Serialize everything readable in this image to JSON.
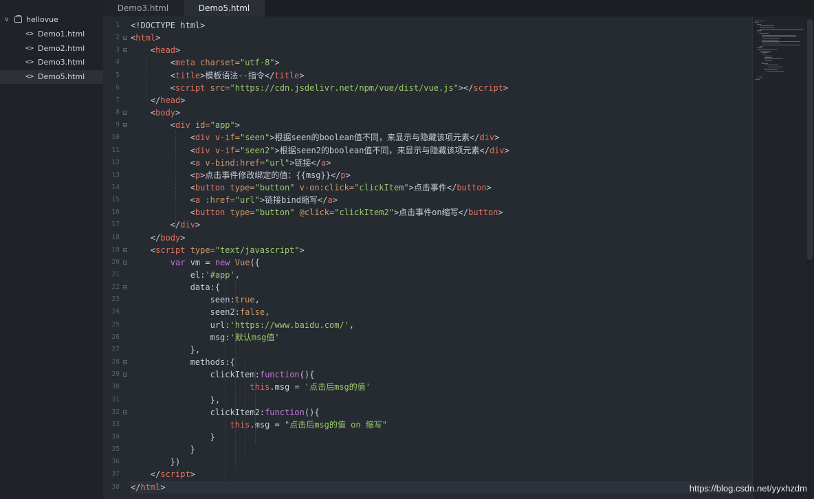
{
  "sidebar": {
    "folder": "hellovue",
    "files": [
      "Demo1.html",
      "Demo2.html",
      "Demo3.html",
      "Demo5.html"
    ],
    "active_index": 3,
    "folder_icon": "folder-icon",
    "file_icon": "code-file-icon"
  },
  "tabs": [
    {
      "label": "Demo3.html",
      "active": false
    },
    {
      "label": "Demo5.html",
      "active": true
    }
  ],
  "editor": {
    "current_line": 38,
    "foldable_lines": [
      2,
      3,
      8,
      9,
      19,
      20,
      22,
      28,
      29,
      32
    ],
    "lines": [
      [
        [
          "<!DOCTYPE html>",
          "k-plain"
        ]
      ],
      [
        [
          "<",
          "k-punct"
        ],
        [
          "html",
          "k-tag"
        ],
        [
          ">",
          "k-punct"
        ]
      ],
      [
        [
          "    <",
          "k-punct"
        ],
        [
          "head",
          "k-tag"
        ],
        [
          ">",
          "k-punct"
        ]
      ],
      [
        [
          "        <",
          "k-punct"
        ],
        [
          "meta",
          "k-tag"
        ],
        [
          " charset=",
          "k-attr"
        ],
        [
          "\"utf-8\"",
          "k-str"
        ],
        [
          ">",
          "k-punct"
        ]
      ],
      [
        [
          "        <",
          "k-punct"
        ],
        [
          "title",
          "k-tag"
        ],
        [
          ">模板语法--指令</",
          "k-punct"
        ],
        [
          "title",
          "k-tag"
        ],
        [
          ">",
          "k-punct"
        ]
      ],
      [
        [
          "        <",
          "k-punct"
        ],
        [
          "script",
          "k-tag"
        ],
        [
          " src=",
          "k-attr"
        ],
        [
          "\"https://cdn.jsdelivr.net/npm/vue/dist/vue.js\"",
          "k-str"
        ],
        [
          "></",
          "k-punct"
        ],
        [
          "script",
          "k-tag"
        ],
        [
          ">",
          "k-punct"
        ]
      ],
      [
        [
          "    </",
          "k-punct"
        ],
        [
          "head",
          "k-tag"
        ],
        [
          ">",
          "k-punct"
        ]
      ],
      [
        [
          "    <",
          "k-punct"
        ],
        [
          "body",
          "k-tag"
        ],
        [
          ">",
          "k-punct"
        ]
      ],
      [
        [
          "        <",
          "k-punct"
        ],
        [
          "div",
          "k-tag"
        ],
        [
          " id=",
          "k-attr"
        ],
        [
          "\"app\"",
          "k-str"
        ],
        [
          ">",
          "k-punct"
        ]
      ],
      [
        [
          "            <",
          "k-punct"
        ],
        [
          "div",
          "k-tag"
        ],
        [
          " v-if=",
          "k-attr"
        ],
        [
          "\"seen\"",
          "k-str"
        ],
        [
          ">根据seen的boolean值不同，来显示与隐藏该项元素</",
          "k-punct"
        ],
        [
          "div",
          "k-tag"
        ],
        [
          ">",
          "k-punct"
        ]
      ],
      [
        [
          "            <",
          "k-punct"
        ],
        [
          "div",
          "k-tag"
        ],
        [
          " v-if=",
          "k-attr"
        ],
        [
          "\"seen2\"",
          "k-str"
        ],
        [
          ">根据seen2的boolean值不同，来显示与隐藏该项元素</",
          "k-punct"
        ],
        [
          "div",
          "k-tag"
        ],
        [
          ">",
          "k-punct"
        ]
      ],
      [
        [
          "            <",
          "k-punct"
        ],
        [
          "a",
          "k-tag"
        ],
        [
          " v-bind:href=",
          "k-attr"
        ],
        [
          "\"url\"",
          "k-str"
        ],
        [
          ">链接</",
          "k-punct"
        ],
        [
          "a",
          "k-tag"
        ],
        [
          ">",
          "k-punct"
        ]
      ],
      [
        [
          "            <",
          "k-punct"
        ],
        [
          "p",
          "k-tag"
        ],
        [
          ">点击事件修改绑定的值：{{msg}}</",
          "k-punct"
        ],
        [
          "p",
          "k-tag"
        ],
        [
          ">",
          "k-punct"
        ]
      ],
      [
        [
          "            <",
          "k-punct"
        ],
        [
          "button",
          "k-tag"
        ],
        [
          " type=",
          "k-attr"
        ],
        [
          "\"button\"",
          "k-str"
        ],
        [
          " v-on:click=",
          "k-attr"
        ],
        [
          "\"clickItem\"",
          "k-str"
        ],
        [
          ">点击事件</",
          "k-punct"
        ],
        [
          "button",
          "k-tag"
        ],
        [
          ">",
          "k-punct"
        ]
      ],
      [
        [
          "            <",
          "k-punct"
        ],
        [
          "a",
          "k-tag"
        ],
        [
          " :href=",
          "k-attr"
        ],
        [
          "\"url\"",
          "k-str"
        ],
        [
          ">链接bind缩写</",
          "k-punct"
        ],
        [
          "a",
          "k-tag"
        ],
        [
          ">",
          "k-punct"
        ]
      ],
      [
        [
          "            <",
          "k-punct"
        ],
        [
          "button",
          "k-tag"
        ],
        [
          " type=",
          "k-attr"
        ],
        [
          "\"button\"",
          "k-str"
        ],
        [
          " @click=",
          "k-attr"
        ],
        [
          "\"clickItem2\"",
          "k-str"
        ],
        [
          ">点击事件on缩写</",
          "k-punct"
        ],
        [
          "button",
          "k-tag"
        ],
        [
          ">",
          "k-punct"
        ]
      ],
      [
        [
          "        </",
          "k-punct"
        ],
        [
          "div",
          "k-tag"
        ],
        [
          ">",
          "k-punct"
        ]
      ],
      [
        [
          "    </",
          "k-punct"
        ],
        [
          "body",
          "k-tag"
        ],
        [
          ">",
          "k-punct"
        ]
      ],
      [
        [
          "    <",
          "k-punct"
        ],
        [
          "script",
          "k-tag"
        ],
        [
          " type=",
          "k-attr"
        ],
        [
          "\"text/javascript\"",
          "k-str"
        ],
        [
          ">",
          "k-punct"
        ]
      ],
      [
        [
          "        ",
          "k-plain"
        ],
        [
          "var",
          "k-kw"
        ],
        [
          " vm = ",
          "k-plain"
        ],
        [
          "new",
          "k-kw"
        ],
        [
          " ",
          "k-plain"
        ],
        [
          "Vue",
          "k-attr"
        ],
        [
          "({",
          "k-plain"
        ]
      ],
      [
        [
          "            el:",
          "k-plain"
        ],
        [
          "'#app'",
          "k-str"
        ],
        [
          ",",
          "k-plain"
        ]
      ],
      [
        [
          "            data:{",
          "k-plain"
        ]
      ],
      [
        [
          "                seen:",
          "k-plain"
        ],
        [
          "true",
          "k-attr"
        ],
        [
          ",",
          "k-plain"
        ]
      ],
      [
        [
          "                seen2:",
          "k-plain"
        ],
        [
          "false",
          "k-attr"
        ],
        [
          ",",
          "k-plain"
        ]
      ],
      [
        [
          "                url:",
          "k-plain"
        ],
        [
          "'https://www.baidu.com/'",
          "k-str"
        ],
        [
          ",",
          "k-plain"
        ]
      ],
      [
        [
          "                msg:",
          "k-plain"
        ],
        [
          "'默认msg值'",
          "k-str"
        ]
      ],
      [
        [
          "            },",
          "k-plain"
        ]
      ],
      [
        [
          "            methods:{",
          "k-plain"
        ]
      ],
      [
        [
          "                clickItem:",
          "k-plain"
        ],
        [
          "function",
          "k-kw"
        ],
        [
          "(){",
          "k-plain"
        ]
      ],
      [
        [
          "                        ",
          "k-plain"
        ],
        [
          "this",
          "k-tag"
        ],
        [
          ".msg = ",
          "k-plain"
        ],
        [
          "'点击后msg的值'",
          "k-str"
        ]
      ],
      [
        [
          "                },",
          "k-plain"
        ]
      ],
      [
        [
          "                clickItem2:",
          "k-plain"
        ],
        [
          "function",
          "k-kw"
        ],
        [
          "(){",
          "k-plain"
        ]
      ],
      [
        [
          "                    ",
          "k-plain"
        ],
        [
          "this",
          "k-tag"
        ],
        [
          ".msg = ",
          "k-plain"
        ],
        [
          "\"点击后msg的值 on 缩写\"",
          "k-str"
        ]
      ],
      [
        [
          "                }",
          "k-plain"
        ]
      ],
      [
        [
          "            }",
          "k-plain"
        ]
      ],
      [
        [
          "        })",
          "k-plain"
        ]
      ],
      [
        [
          "    </",
          "k-punct"
        ],
        [
          "script",
          "k-tag"
        ],
        [
          ">",
          "k-punct"
        ]
      ],
      [
        [
          "</",
          "k-punct"
        ],
        [
          "html",
          "k-tag"
        ],
        [
          ">",
          "k-punct"
        ]
      ]
    ]
  },
  "watermark": "https://blog.csdn.net/yyxhzdm"
}
